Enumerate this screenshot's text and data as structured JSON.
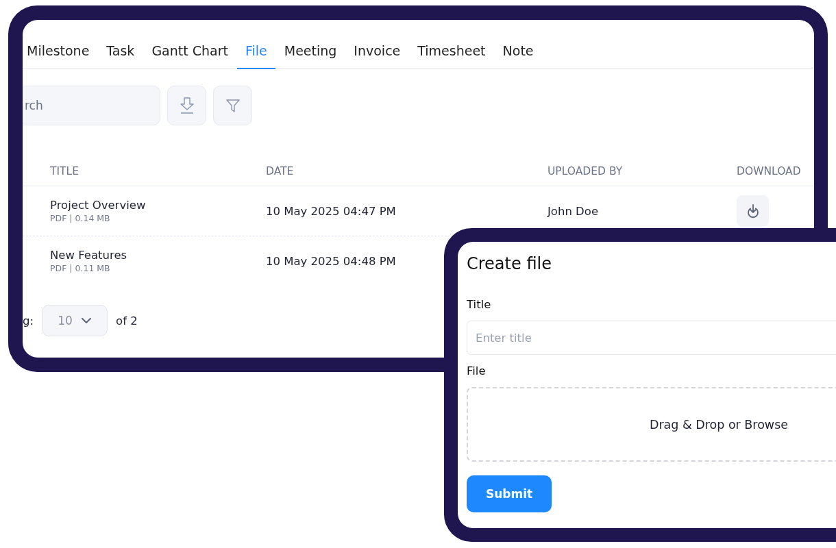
{
  "file_window": {
    "tabs": [
      {
        "label": "Milestone",
        "selected": false
      },
      {
        "label": "Task",
        "selected": false
      },
      {
        "label": "Gantt Chart",
        "selected": false
      },
      {
        "label": "File",
        "selected": true
      },
      {
        "label": "Meeting",
        "selected": false
      },
      {
        "label": "Invoice",
        "selected": false
      },
      {
        "label": "Timesheet",
        "selected": false
      },
      {
        "label": "Note",
        "selected": false
      }
    ],
    "search": {
      "placeholder": "rch"
    },
    "table": {
      "columns": [
        "TITLE",
        "DATE",
        "UPLOADED BY",
        "DOWNLOAD"
      ],
      "rows": [
        {
          "title": "Project Overview",
          "meta": "PDF | 0.14 MB",
          "date": "10 May 2025 04:47 PM",
          "uploaded_by": "John Doe",
          "download": true
        },
        {
          "title": "New Features",
          "meta": "PDF | 0.11 MB",
          "date": "10 May 2025 04:48 PM"
        }
      ]
    },
    "pagination": {
      "label": "g:",
      "page_size": "10",
      "total": "of 2"
    }
  },
  "create_dialog": {
    "title": "Create file",
    "fields": [
      {
        "kind": "text",
        "label": "Title",
        "placeholder": "Enter title"
      },
      {
        "kind": "drop",
        "label": "File",
        "hint": "Drag & Drop or Browse"
      }
    ],
    "submit": "Submit"
  }
}
